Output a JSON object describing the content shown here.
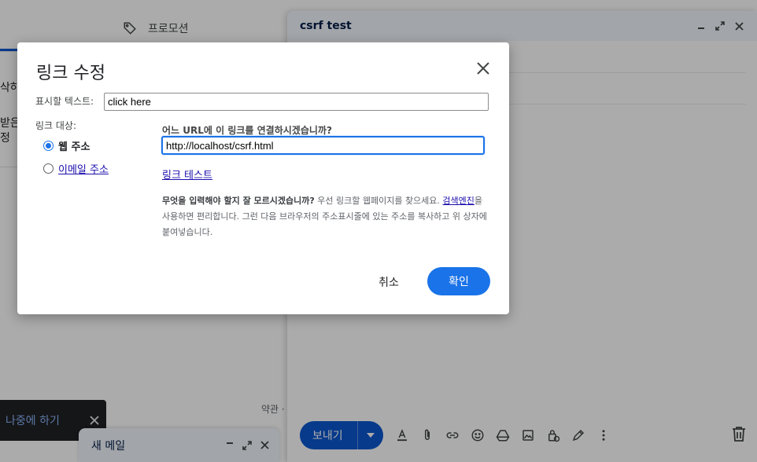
{
  "background": {
    "promotions_tab_label": "프로모션",
    "mail_fragments": [
      "삭하",
      "받은",
      "정"
    ],
    "terms_text": "약관 ·"
  },
  "compose": {
    "title": "csrf test",
    "send_label": "보내기",
    "header_icons": [
      "minimize-icon",
      "expand-icon",
      "close-icon"
    ],
    "toolbar_icons": [
      "format-text-icon",
      "attach-icon",
      "link-icon",
      "emoji-icon",
      "drive-icon",
      "photo-icon",
      "confidential-icon",
      "signature-icon",
      "more-options-icon"
    ],
    "delete_icon": "trash-icon",
    "brand_color": "#0b57d0"
  },
  "snackbar": {
    "text": "나중에 하기"
  },
  "new_message": {
    "title": "새 메일"
  },
  "dialog": {
    "title": "링크 수정",
    "display_text_label": "표시할 텍스트:",
    "display_text_value": "click here",
    "link_target_label": "링크 대상:",
    "options": [
      {
        "label": "웹 주소",
        "selected": true
      },
      {
        "label": "이메일 주소",
        "selected": false
      }
    ],
    "url_question": "어느 URL에 이 링크를 연결하시겠습니까?",
    "url_value": "http://localhost/csrf.html",
    "test_link": "링크 테스트",
    "help_bold": "무엇을 입력해야 할지 잘 모르시겠습니까?",
    "help_before_link": "우선 링크할 웹페이지를 찾으세요.",
    "help_link": "검색엔진",
    "help_after_link": "을 사용하면 편리합니다. 그런 다음 브라우저의 주소표시줄에 있는 주소를 복사하고 위 상자에 붙여넣습니다.",
    "cancel_label": "취소",
    "ok_label": "확인",
    "accent_color": "#1a73e8"
  }
}
